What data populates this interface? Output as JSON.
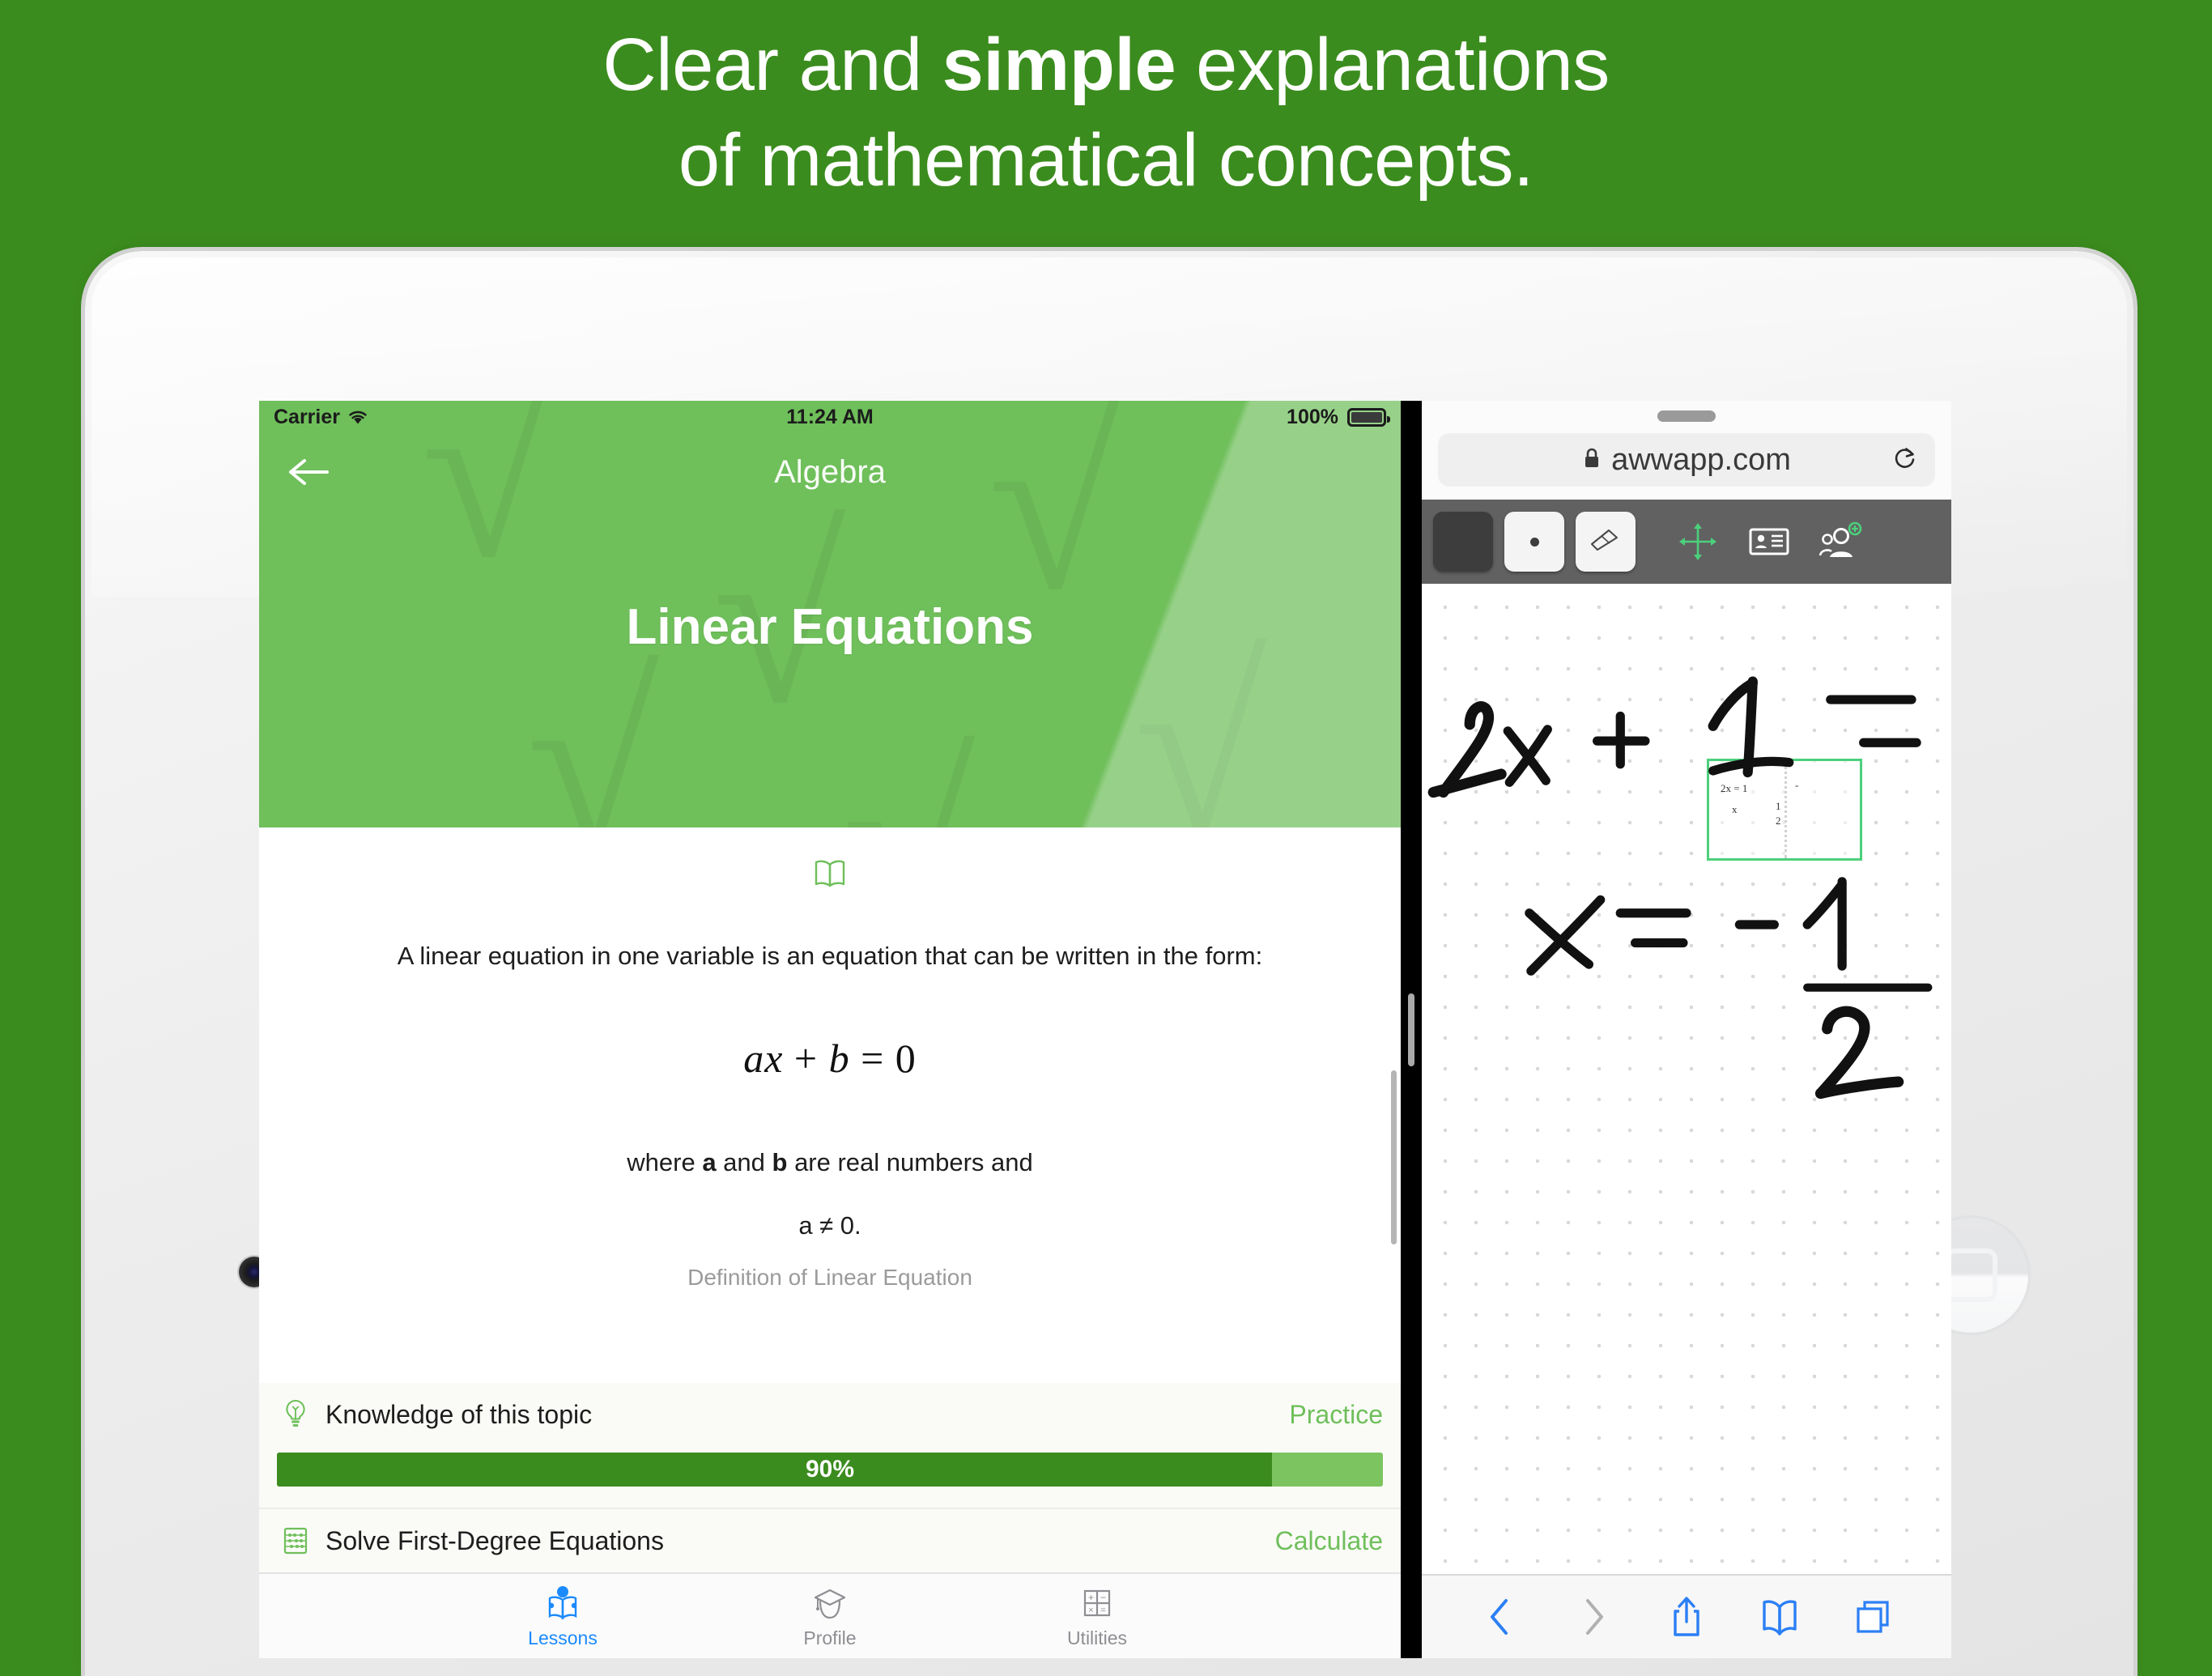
{
  "promo": {
    "line1_a": "Clear and ",
    "line1_bold": "simple",
    "line1_b": " explanations",
    "line2": "of mathematical concepts.",
    "background_color": "#3B8C1E"
  },
  "app": {
    "status_bar": {
      "carrier": "Carrier",
      "wifi_icon": "wifi-icon",
      "time": "11:24 AM",
      "battery_percent": "100%",
      "battery_icon": "battery-full-icon"
    },
    "navbar": {
      "back_icon": "back-arrow-icon",
      "title": "Algebra"
    },
    "lesson": {
      "title": "Linear Equations",
      "header_color": "#6FBF5B",
      "book_icon": "open-book-icon",
      "definition": "A linear equation in one variable is an equation that can be written in the form:",
      "formula": "ax + b = 0",
      "formula_a": "ax",
      "formula_plus": " + ",
      "formula_b": "b",
      "formula_eq": " = ",
      "formula_zero": "0",
      "where_prefix": "where ",
      "where_a": "a",
      "where_mid": " and ",
      "where_b": "b",
      "where_suffix": " are real numbers and",
      "condition": "a ≠ 0.",
      "source": "Definition of Linear Equation"
    },
    "topics": [
      {
        "icon": "lightbulb-icon",
        "label": "Knowledge of this topic",
        "action": "Practice",
        "progress_label": "90%",
        "progress_percent": 90,
        "fill_color": "#3B8C1E",
        "track_color": "#7CC45F"
      },
      {
        "icon": "abacus-icon",
        "label": "Solve First-Degree Equations",
        "action": "Calculate"
      }
    ],
    "tabs": [
      {
        "icon": "person-reading-icon",
        "label": "Lessons",
        "active": true,
        "color": "#1b8afc"
      },
      {
        "icon": "graduation-cap-icon",
        "label": "Profile",
        "active": false,
        "color": "#8e8e93"
      },
      {
        "icon": "calculator-icon",
        "label": "Utilities",
        "active": false,
        "color": "#8e8e93"
      }
    ]
  },
  "safari": {
    "grabber_icon": "drag-grabber-icon",
    "url": "awwapp.com",
    "lock_icon": "lock-icon",
    "reload_icon": "reload-icon",
    "whiteboard_toolbar": [
      {
        "icon": "color-swatch-dark",
        "type": "swatch"
      },
      {
        "icon": "pen-tool-icon",
        "type": "tool"
      },
      {
        "icon": "eraser-tool-icon",
        "type": "tool"
      },
      {
        "icon": "move-tool-icon",
        "type": "icon",
        "color": "#4CD07C"
      },
      {
        "icon": "id-card-icon",
        "type": "icon",
        "color": "#ffffff"
      },
      {
        "icon": "add-people-icon",
        "type": "icon",
        "color": "#ffffff",
        "badge_color": "#4CD07C"
      }
    ],
    "whiteboard": {
      "handwriting_line1": "2x + 1 =",
      "handwriting_line2": "x = - 1/2",
      "minimap_icon": "viewport-minimap"
    },
    "bottom_bar": [
      {
        "icon": "back-chevron-icon",
        "enabled": true,
        "color": "#2b7ff5"
      },
      {
        "icon": "forward-chevron-icon",
        "enabled": false,
        "color": "#b0b0b0"
      },
      {
        "icon": "share-icon",
        "enabled": true,
        "color": "#2b7ff5"
      },
      {
        "icon": "bookmarks-icon",
        "enabled": true,
        "color": "#2b7ff5"
      },
      {
        "icon": "tabs-icon",
        "enabled": true,
        "color": "#2b7ff5"
      }
    ]
  },
  "device": {
    "camera_icon": "front-camera",
    "home_button_icon": "home-button"
  }
}
